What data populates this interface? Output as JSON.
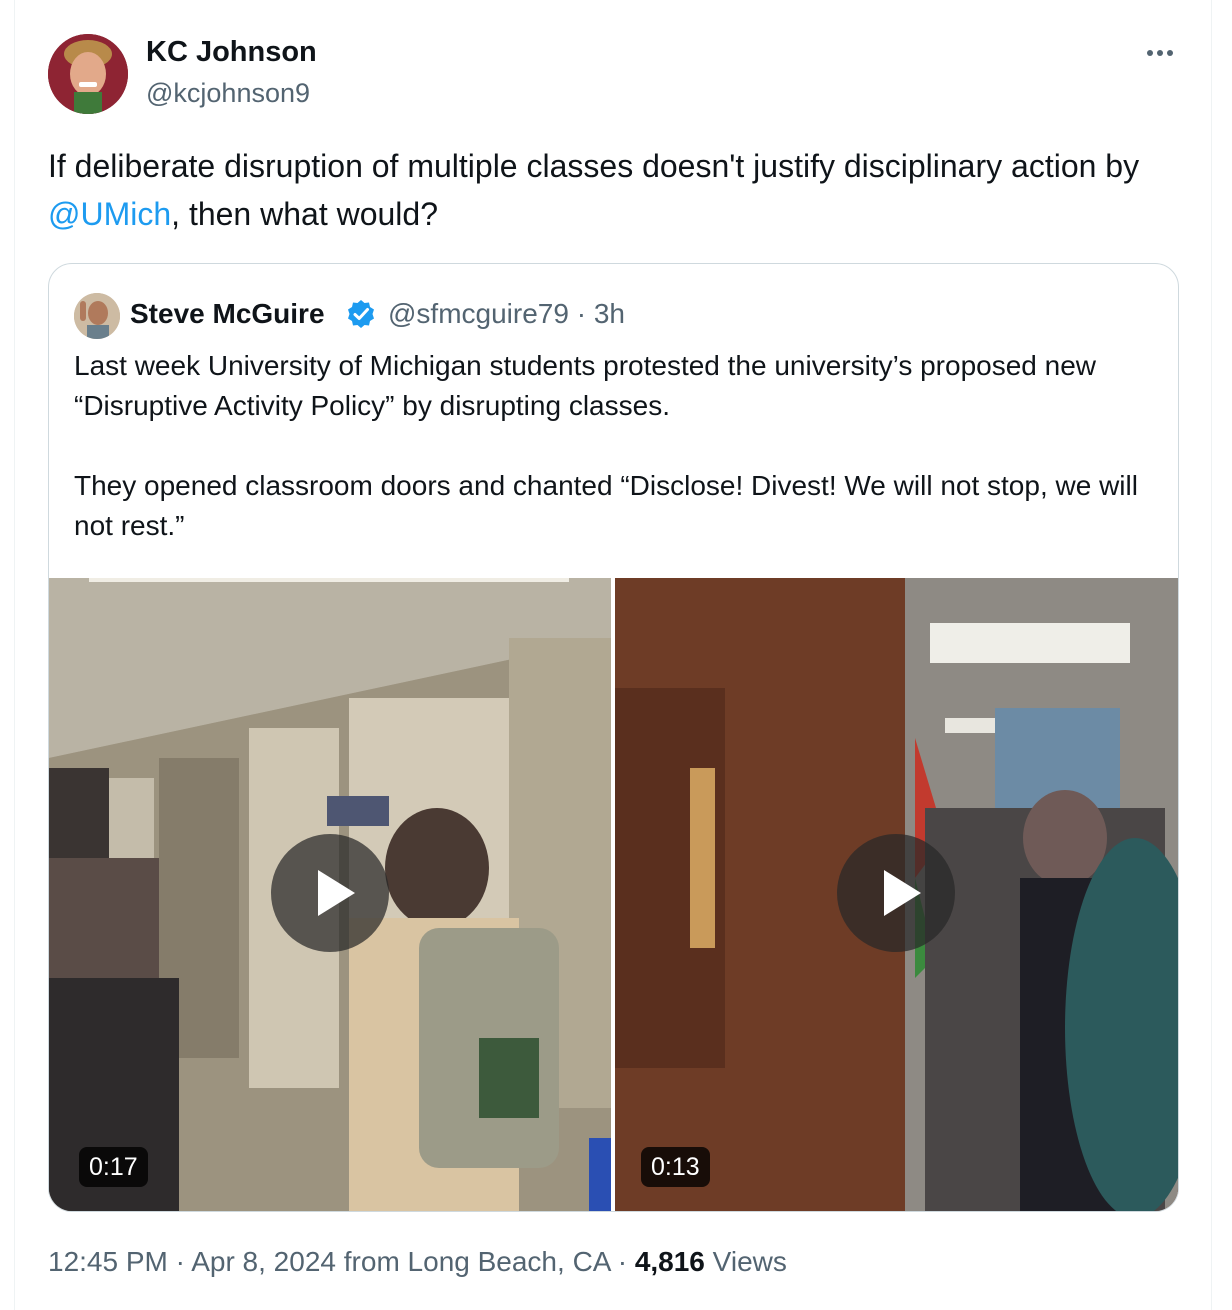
{
  "tweet": {
    "author_name": "KC Johnson",
    "author_handle": "@kcjohnson9",
    "more_icon": "ellipsis-icon",
    "text_before": "If deliberate disruption of multiple classes doesn't justify disciplinary action by ",
    "mention": "@UMich",
    "text_after": ", then what would?"
  },
  "quote": {
    "author_name": "Steve McGuire",
    "verified_icon": "verified-badge-icon",
    "author_handle": "@sfmcguire79",
    "separator": "·",
    "time_ago": "3h",
    "paragraph_1": "Last week University of Michigan students protested the university’s proposed new “Disruptive Activity Policy” by disrupting classes.",
    "paragraph_2": "They opened classroom doors and chanted “Disclose! Divest! We will not stop, we will not rest.”",
    "videos": [
      {
        "duration": "0:17",
        "icon": "play-icon"
      },
      {
        "duration": "0:13",
        "icon": "play-icon"
      }
    ]
  },
  "footer": {
    "time": "12:45 PM",
    "date": "Apr 8, 2024",
    "location_text": "from Long Beach, CA",
    "separator": "·",
    "views_count": "4,816",
    "views_label": "Views"
  },
  "colors": {
    "text_primary": "#0f1419",
    "text_secondary": "#536471",
    "link": "#1d9bf0",
    "border": "#cfd9de",
    "verified": "#1d9bf0"
  }
}
